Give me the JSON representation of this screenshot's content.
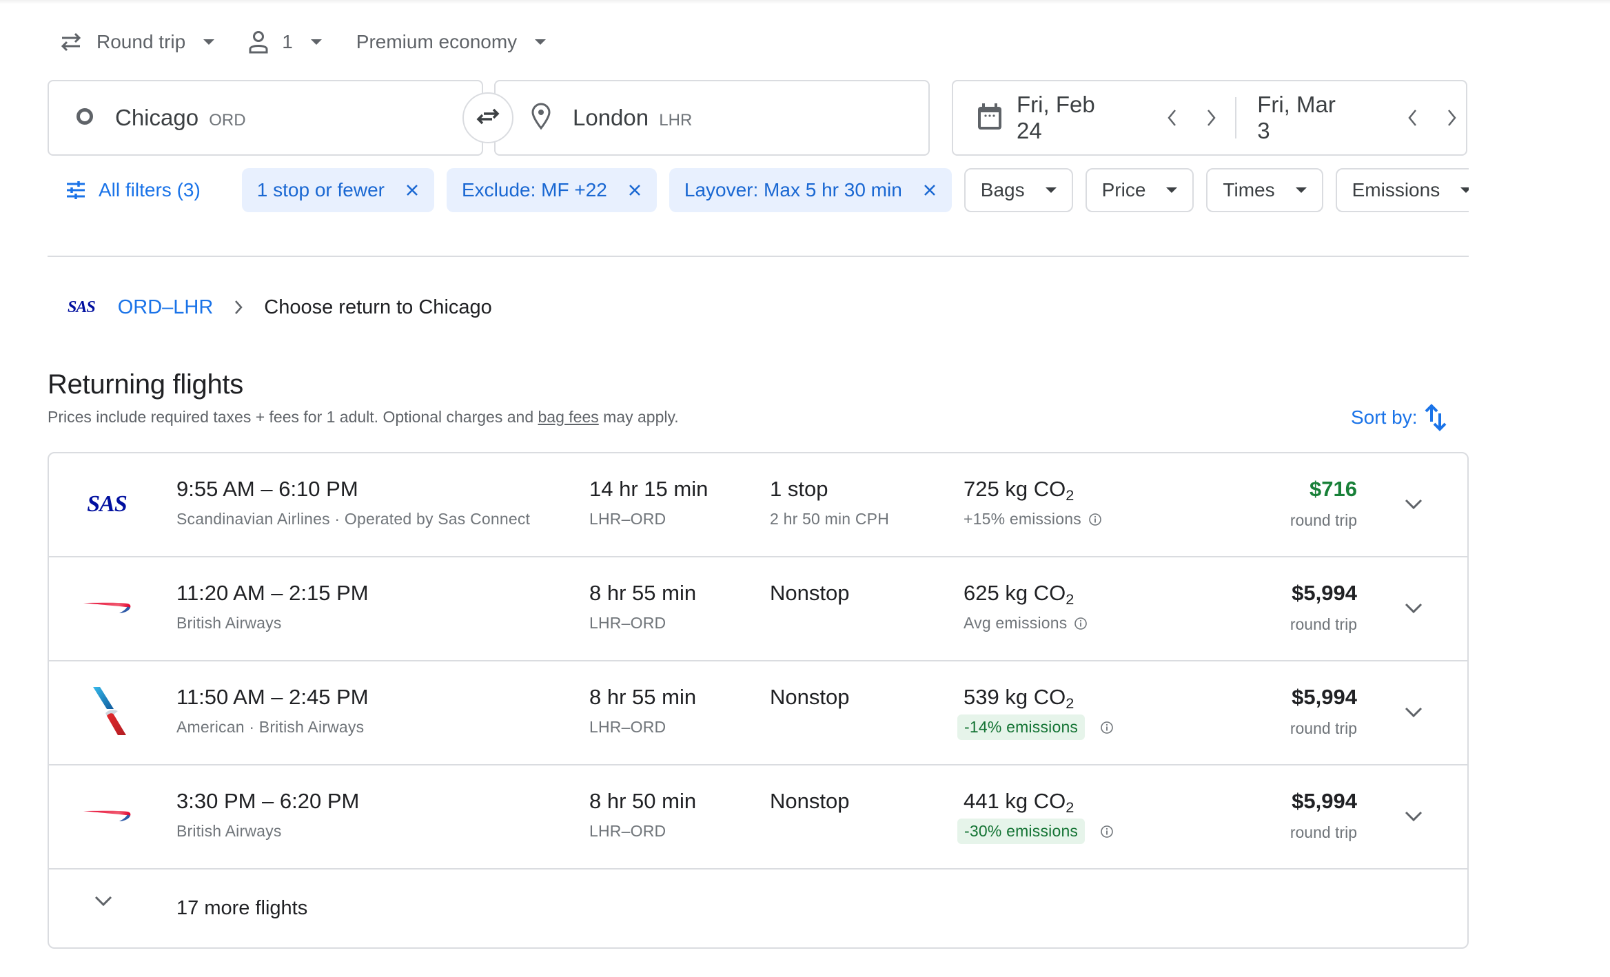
{
  "trip_options": {
    "trip_type": "Round trip",
    "passengers": "1",
    "cabin_class": "Premium economy"
  },
  "search": {
    "origin_city": "Chicago",
    "origin_code": "ORD",
    "destination_city": "London",
    "destination_code": "LHR",
    "depart_date": "Fri, Feb 24",
    "return_date": "Fri, Mar 3"
  },
  "filters": {
    "all_filters_label": "All filters (3)",
    "active": [
      {
        "label": "1 stop or fewer"
      },
      {
        "label": "Exclude: MF +22"
      },
      {
        "label": "Layover: Max 5 hr 30 min"
      }
    ],
    "dropdowns": [
      {
        "label": "Bags"
      },
      {
        "label": "Price"
      },
      {
        "label": "Times"
      },
      {
        "label": "Emissions"
      }
    ]
  },
  "breadcrumb": {
    "airline_logo": "SAS",
    "outbound_link": "ORD–LHR",
    "current_step": "Choose return to Chicago"
  },
  "results": {
    "title": "Returning flights",
    "disclaimer_prefix": "Prices include required taxes + fees for 1 adult. Optional charges and ",
    "disclaimer_link": "bag fees",
    "disclaimer_suffix": " may apply.",
    "sort_label": "Sort by:",
    "flights": [
      {
        "logo": "sas",
        "logo_text": "SAS",
        "times": "9:55 AM – 6:10 PM",
        "airline": "Scandinavian Airlines · Operated by Sas Connect",
        "duration": "14 hr 15 min",
        "route": "LHR–ORD",
        "stops": "1 stop",
        "layover": "2 hr 50 min CPH",
        "emissions_value": "725 kg CO",
        "emissions_sub": "2",
        "emissions_note": "+15% emissions",
        "emissions_badge": false,
        "price": "$716",
        "price_type": "round trip",
        "price_color": "#188038"
      },
      {
        "logo": "british-airways",
        "times": "11:20 AM – 2:15 PM",
        "airline": "British Airways",
        "duration": "8 hr 55 min",
        "route": "LHR–ORD",
        "stops": "Nonstop",
        "layover": "",
        "emissions_value": "625 kg CO",
        "emissions_sub": "2",
        "emissions_note": "Avg emissions",
        "emissions_badge": false,
        "price": "$5,994",
        "price_type": "round trip"
      },
      {
        "logo": "american-airlines",
        "times": "11:50 AM – 2:45 PM",
        "airline": "American · British Airways",
        "duration": "8 hr 55 min",
        "route": "LHR–ORD",
        "stops": "Nonstop",
        "layover": "",
        "emissions_value": "539 kg CO",
        "emissions_sub": "2",
        "emissions_note": "-14% emissions",
        "emissions_badge": true,
        "price": "$5,994",
        "price_type": "round trip"
      },
      {
        "logo": "british-airways",
        "times": "3:30 PM – 6:20 PM",
        "airline": "British Airways",
        "duration": "8 hr 50 min",
        "route": "LHR–ORD",
        "stops": "Nonstop",
        "layover": "",
        "emissions_value": "441 kg CO",
        "emissions_sub": "2",
        "emissions_note": "-30% emissions",
        "emissions_badge": true,
        "price": "$5,994",
        "price_type": "round trip"
      }
    ],
    "more_flights_label": "17 more flights"
  },
  "icons": {
    "trip_type": "swap-horizontal-arrows-icon",
    "passengers": "person-icon",
    "origin": "circle-icon",
    "destination": "location-pin-icon",
    "swap": "swap-arrows-icon",
    "calendar": "calendar-icon",
    "filters": "tune-sliders-icon",
    "remove_filter": "close-icon",
    "sort": "sort-arrows-icon",
    "info": "info-icon",
    "expand": "chevron-down-icon"
  },
  "colors": {
    "accent": "#1a73e8",
    "active_chip_bg": "#e8f0fe",
    "deal_price": "#188038",
    "green_badge_bg": "#e6f4ea",
    "green_badge_text": "#137333",
    "border": "#dadce0"
  }
}
